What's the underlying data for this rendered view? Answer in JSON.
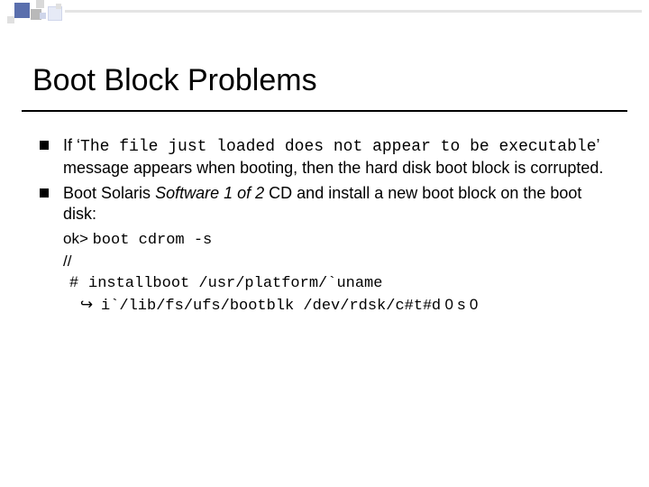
{
  "title": "Boot Block Problems",
  "bullets": [
    {
      "pre": "If",
      "code": "The file just loaded does not appear to be executable",
      "post": "message appears when booting, then the hard disk boot block is corrupted."
    },
    {
      "pre": "Boot Solaris",
      "italic": "Software 1 of 2",
      "post": "CD and install a new boot block on the boot disk:"
    }
  ],
  "code": {
    "prompt1": "ok> ",
    "cmd1": "boot cdrom -s",
    "prompt2": "//",
    "cmd2a": "installboot /usr/platform/`uname",
    "cmd2b": "i`/lib/fs/ufs/bootblk /dev/rdsk/c#t#",
    "cmd2b_sans": "d 0 s 0"
  }
}
